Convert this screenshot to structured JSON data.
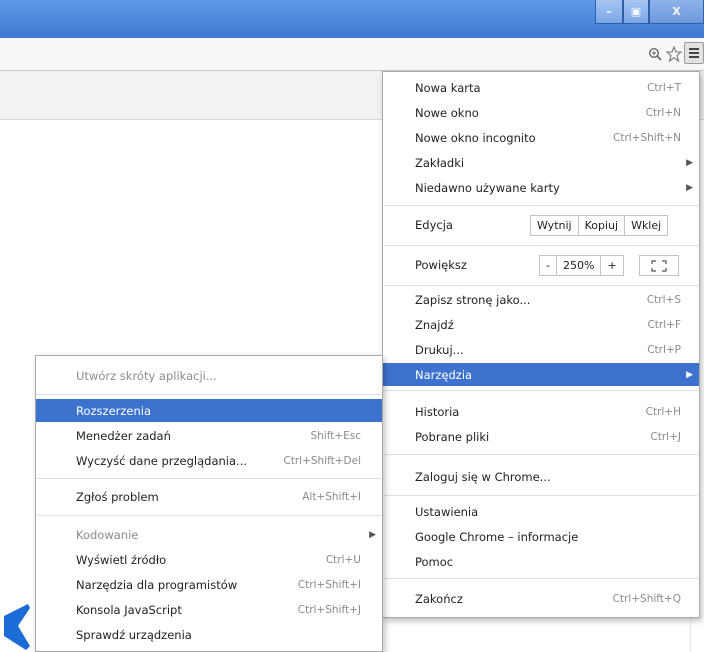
{
  "window": {
    "controls": {
      "minimize": "–",
      "maximize": "▣",
      "close": "X"
    }
  },
  "toolbar": {
    "zoom_icon": "magnifier-zoom-icon",
    "star_icon": "bookmark-star-icon",
    "menu_icon": "hamburger-menu-icon"
  },
  "main_menu": {
    "new_tab": {
      "label": "Nowa karta",
      "shortcut": "Ctrl+T"
    },
    "new_window": {
      "label": "Nowe okno",
      "shortcut": "Ctrl+N"
    },
    "incognito": {
      "label": "Nowe okno incognito",
      "shortcut": "Ctrl+Shift+N"
    },
    "bookmarks": {
      "label": "Zakładki"
    },
    "recent_tabs": {
      "label": "Niedawno używane karty"
    },
    "edit": {
      "label": "Edycja",
      "cut": "Wytnij",
      "copy": "Kopiuj",
      "paste": "Wklej"
    },
    "zoom": {
      "label": "Powiększ",
      "minus": "-",
      "value": "250%",
      "plus": "+"
    },
    "save_page": {
      "label": "Zapisz stronę jako...",
      "shortcut": "Ctrl+S"
    },
    "find": {
      "label": "Znajdź",
      "shortcut": "Ctrl+F"
    },
    "print": {
      "label": "Drukuj...",
      "shortcut": "Ctrl+P"
    },
    "tools": {
      "label": "Narzędzia"
    },
    "history": {
      "label": "Historia",
      "shortcut": "Ctrl+H"
    },
    "downloads": {
      "label": "Pobrane pliki",
      "shortcut": "Ctrl+J"
    },
    "signin": {
      "label": "Zaloguj się w Chrome..."
    },
    "settings": {
      "label": "Ustawienia"
    },
    "about": {
      "label": "Google Chrome – informacje"
    },
    "help": {
      "label": "Pomoc"
    },
    "exit": {
      "label": "Zakończ",
      "shortcut": "Ctrl+Shift+Q"
    }
  },
  "tools_menu": {
    "create_shortcuts": {
      "label": "Utwórz skróty aplikacji..."
    },
    "extensions": {
      "label": "Rozszerzenia"
    },
    "task_manager": {
      "label": "Menedżer zadań",
      "shortcut": "Shift+Esc"
    },
    "clear_data": {
      "label": "Wyczyść dane przeglądania...",
      "shortcut": "Ctrl+Shift+Del"
    },
    "report_issue": {
      "label": "Zgłoś problem",
      "shortcut": "Alt+Shift+I"
    },
    "encoding": {
      "label": "Kodowanie"
    },
    "view_source": {
      "label": "Wyświetl źródło",
      "shortcut": "Ctrl+U"
    },
    "dev_tools": {
      "label": "Narzędzia dla programistów",
      "shortcut": "Ctrl+Shift+I"
    },
    "js_console": {
      "label": "Konsola JavaScript",
      "shortcut": "Ctrl+Shift+J"
    },
    "inspect_devices": {
      "label": "Sprawdź urządzenia"
    }
  },
  "colors": {
    "titlebar": "#4b86da",
    "highlight": "#3d73cf"
  }
}
